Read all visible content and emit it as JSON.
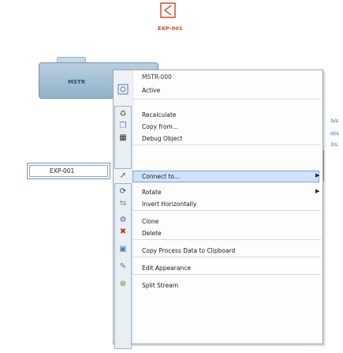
{
  "top_unit": {
    "label": "EXP-001"
  },
  "bg_unit": {
    "label": "MSTR"
  },
  "right_snippets": [
    "b/s",
    "ol/s",
    "3/s",
    "/s"
  ],
  "expanded_row": {
    "label": "EXP-001"
  },
  "menu": {
    "header": "MSTR-000",
    "items": [
      {
        "label": "Active",
        "icon": "checkbox-icon"
      },
      {
        "label": "Recalculate",
        "icon": "recalculate-icon"
      },
      {
        "label": "Copy from...",
        "icon": "copy-from-icon"
      },
      {
        "label": "Debug Object",
        "icon": "debug-icon"
      },
      {
        "label": "Connect to...",
        "icon": "connect-icon",
        "submenu": true,
        "highlighted": true
      },
      {
        "label": "Rotate",
        "icon": "rotate-icon",
        "submenu": true
      },
      {
        "label": "Invert Horizontally",
        "icon": "invert-icon"
      },
      {
        "label": "Clone",
        "icon": "clone-icon"
      },
      {
        "label": "Delete",
        "icon": "delete-icon"
      },
      {
        "label": "Copy Process Data to Clipboard",
        "icon": "clipboard-icon"
      },
      {
        "label": "Edit Appearance",
        "icon": "edit-appearance-icon"
      },
      {
        "label": "Split Stream",
        "icon": "split-stream-icon"
      }
    ]
  },
  "colors": {
    "accent": "#d04020",
    "highlight": "#cfe2f8",
    "menu_border": "#9aa6b2"
  }
}
